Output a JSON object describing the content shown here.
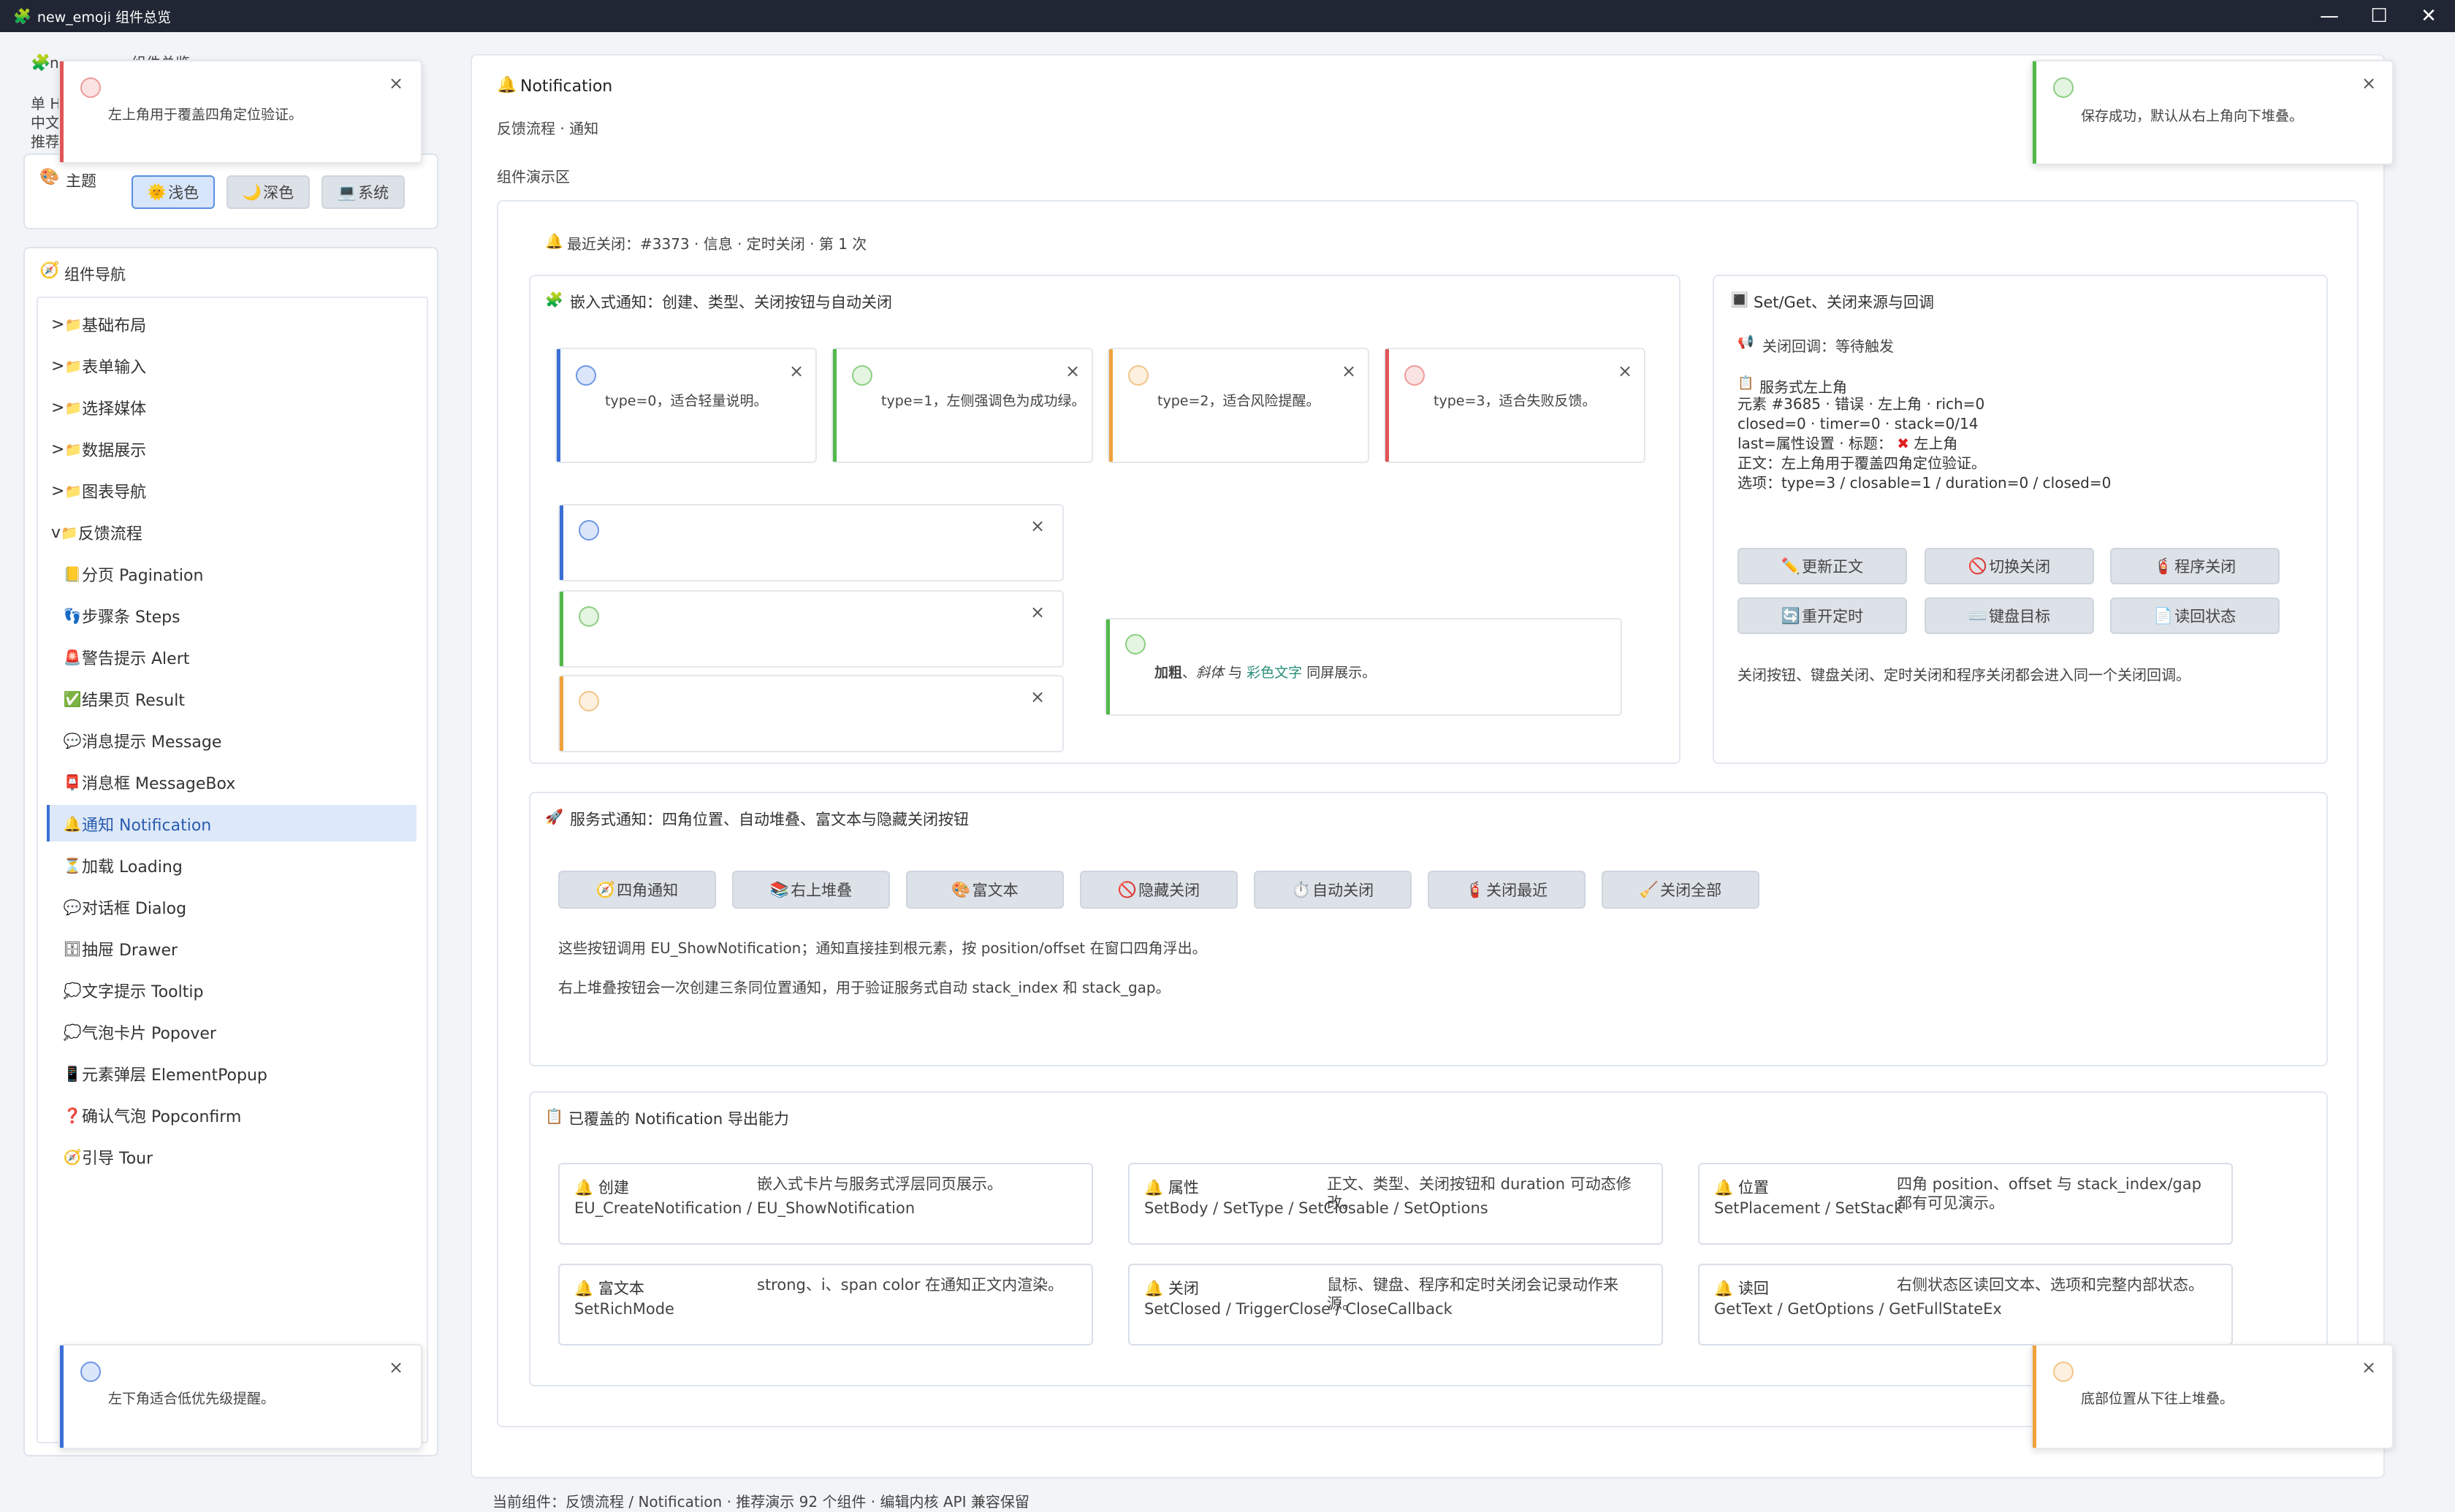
{
  "window": {
    "title": "new_emoji 组件总览",
    "icon": "puzzle-icon"
  },
  "sidebar_top": {
    "line1": "单 H",
    "line2": "中文",
    "line3": "推荐",
    "heading_partial": "…组件总览"
  },
  "theme": {
    "label": "主题",
    "icon": "palette-icon",
    "options": [
      {
        "label": "浅色",
        "icon": "sun-icon"
      },
      {
        "label": "深色",
        "icon": "moon-icon"
      },
      {
        "label": "系统",
        "icon": "laptop-icon"
      }
    ],
    "selected": "浅色"
  },
  "nav": {
    "title": "组件导航",
    "groups": [
      {
        "prefix": ">",
        "label": "基础布局"
      },
      {
        "prefix": ">",
        "label": "表单输入"
      },
      {
        "prefix": ">",
        "label": "选择媒体"
      },
      {
        "prefix": ">",
        "label": "数据展示"
      },
      {
        "prefix": ">",
        "label": "图表导航"
      },
      {
        "prefix": "v",
        "label": "反馈流程"
      }
    ],
    "items": [
      {
        "icon": "📒",
        "label": "分页 Pagination"
      },
      {
        "icon": "👣",
        "label": "步骤条 Steps"
      },
      {
        "icon": "🚨",
        "label": "警告提示 Alert"
      },
      {
        "icon": "✅",
        "label": "结果页 Result"
      },
      {
        "icon": "💬",
        "label": "消息提示 Message"
      },
      {
        "icon": "📮",
        "label": "消息框 MessageBox"
      },
      {
        "icon": "🔔",
        "label": "通知 Notification"
      },
      {
        "icon": "⏳",
        "label": "加载 Loading"
      },
      {
        "icon": "💬",
        "label": "对话框 Dialog"
      },
      {
        "icon": "🗄",
        "label": "抽屉 Drawer"
      },
      {
        "icon": "💭",
        "label": "文字提示 Tooltip"
      },
      {
        "icon": "💭",
        "label": "气泡卡片 Popover"
      },
      {
        "icon": "📱",
        "label": "元素弹层 ElementPopup"
      },
      {
        "icon": "❓",
        "label": "确认气泡 Popconfirm"
      },
      {
        "icon": "🧭",
        "label": "引导 Tour"
      }
    ],
    "selected": "通知 Notification"
  },
  "main": {
    "title": "Notification",
    "breadcrumb": "反馈流程 · 通知",
    "demo_area": "组件演示区",
    "last_closed": "最近关闭：#3373 · 信息 · 定时关闭 · 第 1 次"
  },
  "embedded": {
    "title": "嵌入式通知：创建、类型、关闭按钮与自动关闭",
    "cards": [
      {
        "text": "type=0，适合轻量说明。",
        "color": "#3b6fd6"
      },
      {
        "text": "type=1，左侧强调色为成功绿。",
        "color": "#52b84a"
      },
      {
        "text": "type=2，适合风险提醒。",
        "color": "#f0a23c"
      },
      {
        "text": "type=3，适合失败反馈。",
        "color": "#e05555"
      }
    ],
    "rich_text": {
      "bold": "加粗",
      "sep1": "、",
      "italic": "斜体",
      "sep2": " 与 ",
      "colored": "彩色文字",
      "tail": " 同屏展示。"
    }
  },
  "setget": {
    "title": "Set/Get、关闭来源与回调",
    "callback": "关闭回调：等待触发",
    "state_title": "服务式左上角",
    "state_lines": [
      "元素 #3685 · 错误 · 左上角 · rich=0",
      "closed=0 · timer=0 · stack=0/14",
      "last=属性设置 · 标题：",
      "正文：左上角用于覆盖四角定位验证。",
      "选项：type=3 / closable=1 / duration=0 / closed=0"
    ],
    "state_last_suffix": "左上角",
    "buttons": [
      {
        "icon": "✏️",
        "label": "更新正文"
      },
      {
        "icon": "🚫",
        "label": "切换关闭"
      },
      {
        "icon": "🧯",
        "label": "程序关闭"
      },
      {
        "icon": "🔄",
        "label": "重开定时"
      },
      {
        "icon": "⌨️",
        "label": "键盘目标"
      },
      {
        "icon": "📄",
        "label": "读回状态"
      }
    ],
    "note": "关闭按钮、键盘关闭、定时关闭和程序关闭都会进入同一个关闭回调。"
  },
  "service": {
    "title": "服务式通知：四角位置、自动堆叠、富文本与隐藏关闭按钮",
    "buttons": [
      {
        "icon": "🧭",
        "label": "四角通知"
      },
      {
        "icon": "📚",
        "label": "右上堆叠"
      },
      {
        "icon": "🎨",
        "label": "富文本"
      },
      {
        "icon": "🚫",
        "label": "隐藏关闭"
      },
      {
        "icon": "⏱️",
        "label": "自动关闭"
      },
      {
        "icon": "🧯",
        "label": "关闭最近"
      },
      {
        "icon": "🧹",
        "label": "关闭全部"
      }
    ],
    "desc1": "这些按钮调用 EU_ShowNotification；通知直接挂到根元素，按 position/offset 在窗口四角浮出。",
    "desc2": "右上堆叠按钮会一次创建三条同位置通知，用于验证服务式自动 stack_index 和 stack_gap。"
  },
  "capabilities": {
    "title": "已覆盖的 Notification 导出能力",
    "cards": [
      {
        "name": "创建",
        "fn": "EU_CreateNotification / EU_ShowNotification",
        "desc": "嵌入式卡片与服务式浮层同页展示。"
      },
      {
        "name": "属性",
        "fn": "SetBody / SetType / SetClosable / SetOptions",
        "desc": "正文、类型、关闭按钮和 duration 可动态修改。"
      },
      {
        "name": "位置",
        "fn": "SetPlacement / SetStack",
        "desc": "四角 position、offset 与 stack_index/gap 都有可见演示。"
      },
      {
        "name": "富文本",
        "fn": "SetRichMode",
        "desc": "strong、i、span color 在通知正文内渲染。"
      },
      {
        "name": "关闭",
        "fn": "SetClosed / TriggerClose / CloseCallback",
        "desc": "鼠标、键盘、程序和定时关闭会记录动作来源。"
      },
      {
        "name": "读回",
        "fn": "GetText / GetOptions / GetFullStateEx",
        "desc": "右侧状态区读回文本、选项和完整内部状态。"
      }
    ]
  },
  "toasts": {
    "top_left": "左上角用于覆盖四角定位验证。",
    "top_right": "保存成功，默认从右上角向下堆叠。",
    "bottom_left": "左下角适合低优先级提醒。",
    "bottom_right": "底部位置从下往上堆叠。"
  },
  "status_bar": "当前组件：反馈流程 / Notification · 推荐演示 92 个组件 · 编辑内核 API 兼容保留"
}
